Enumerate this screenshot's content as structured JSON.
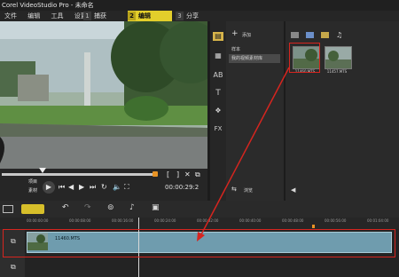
{
  "window": {
    "title": "Corel VideoStudio Pro - 未命名"
  },
  "menu": [
    "文件",
    "编辑",
    "工具",
    "设置"
  ],
  "tabs": [
    {
      "num": "1",
      "label": "捕获",
      "active": false
    },
    {
      "num": "2",
      "label": "编辑",
      "active": true
    },
    {
      "num": "3",
      "label": "分享",
      "active": false
    }
  ],
  "player": {
    "mode_top": "项目",
    "mode_bottom": "素材",
    "timecode": "00:00:29:2",
    "progress": 0.27
  },
  "library": {
    "add_label": "添加",
    "folders": [
      "样本",
      "我的视频素材库"
    ],
    "browse_label": "浏览"
  },
  "clips": [
    {
      "name": "11460.MTS",
      "selected": true
    },
    {
      "name": "11457.MTS",
      "selected": false
    }
  ],
  "timeline": {
    "clip_name": "11460.MTS",
    "ruler_marks": [
      "00:00:00:00",
      "00:00:08:00",
      "00:00:16:00",
      "00:00:24:00",
      "00:00:32:00",
      "00:00:40:00",
      "00:00:48:00",
      "00:00:56:00",
      "00:01:04:00",
      "00:01:12:00"
    ]
  },
  "colors": {
    "accent_tab": "#e3ce2b",
    "highlight": "#d6251f",
    "clip": "#6f9cae",
    "scrub_end": "#e89325"
  }
}
